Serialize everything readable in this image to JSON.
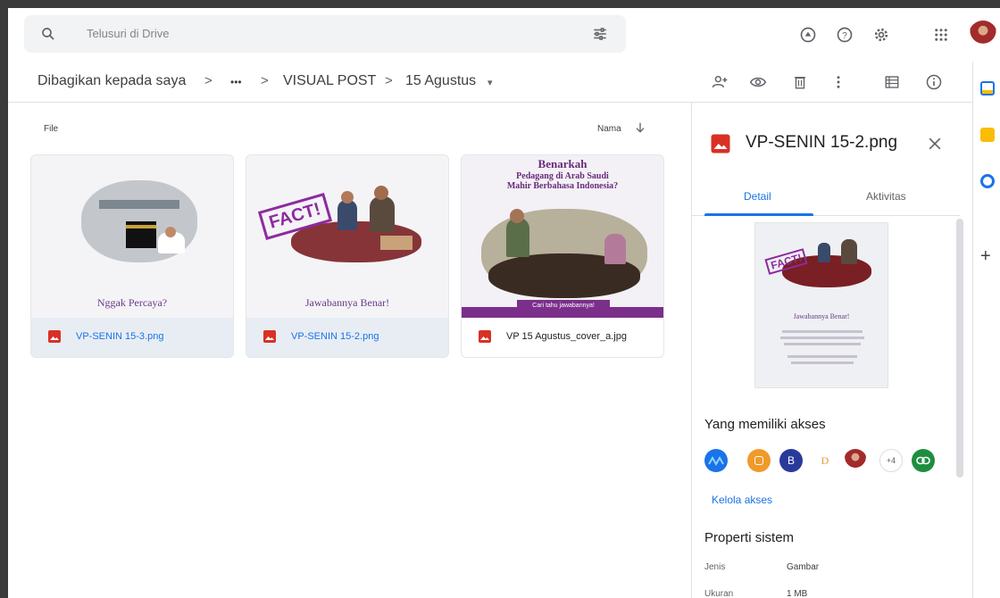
{
  "search": {
    "placeholder": "Telusuri di Drive"
  },
  "breadcrumb": {
    "items": [
      "Dibagikan kepada saya",
      "•••",
      "VISUAL POST",
      "15 Agustus"
    ],
    "separator": ">",
    "dropdown": "▾"
  },
  "list": {
    "column_label": "File",
    "sort_label": "Nama"
  },
  "files": [
    {
      "name": "VP-SENIN 15-3.png",
      "caption": "Nggak Percaya?",
      "selected": false
    },
    {
      "name": "VP-SENIN 15-2.png",
      "caption": "Jawabannya Benar!",
      "selected": true,
      "stamp": "FACT!"
    },
    {
      "name": "VP 15 Agustus_cover_a.jpg",
      "headline": [
        "Benarkah",
        "Pedagang di Arab Saudi",
        "Mahir Berbahasa Indonesia?"
      ],
      "button": "Cari tahu jawabannya!",
      "selected": false
    }
  ],
  "details": {
    "title": "VP-SENIN 15-2.png",
    "tabs": [
      "Detail",
      "Aktivitas"
    ],
    "preview_caption": "Jawabannya Benar!",
    "preview_stamp": "FACT!",
    "access_heading": "Yang memiliki akses",
    "avatars": [
      "B",
      "D",
      "+4"
    ],
    "manage_access": "Kelola akses",
    "system_heading": "Properti sistem",
    "properties": [
      {
        "label": "Jenis",
        "value": "Gambar"
      },
      {
        "label": "Ukuran",
        "value": "1 MB"
      }
    ]
  },
  "colors": {
    "accent": "#1a73e8",
    "selected_card": "#e8edf4",
    "image_icon": "#d93025",
    "link_green": "#1e8e3e"
  }
}
